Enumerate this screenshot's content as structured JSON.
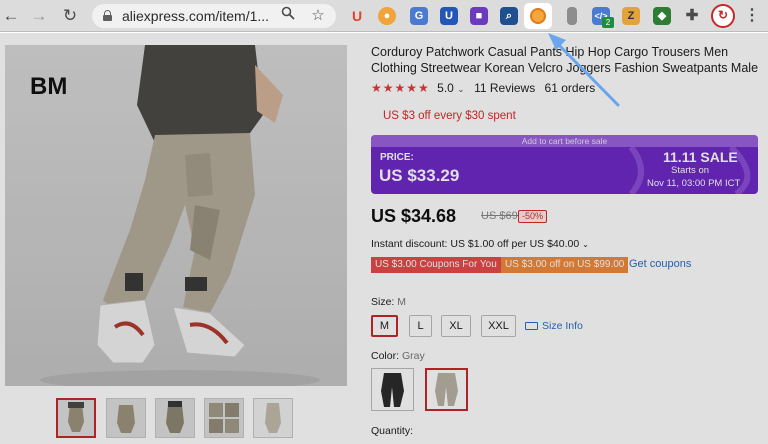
{
  "browser": {
    "url": "aliexpress.com/item/1...",
    "extension_badge": "2"
  },
  "product": {
    "image_label": "BM",
    "title": "Corduroy Patchwork Casual Pants Hip Hop Cargo Trousers Men Clothing Streetwear Korean Velcro Joggers Fashion Sweatpants Male",
    "rating_stars": "★★★★★",
    "rating": "5.0",
    "reviews": "11 Reviews",
    "orders": "61 orders",
    "store_promo": "US $3 off every $30 spent"
  },
  "sale_banner": {
    "top_text": "Add to cart before sale",
    "price_label": "PRICE:",
    "price": "US $33.29",
    "event": "11.11 SALE",
    "starts_label": "Starts on",
    "starts_date": "Nov 11, 03:00 PM ICT"
  },
  "pricing": {
    "current": "US $34.68",
    "original": "US $69.36",
    "discount": "-50%",
    "instant_discount": "Instant discount: US $1.00 off per US $40.00",
    "coupons": [
      "US $3.00 Coupons For You",
      "US $3.00 off on US $99.00"
    ],
    "get_coupons": "Get coupons"
  },
  "size": {
    "label": "Size:",
    "selected": "M",
    "options": [
      "M",
      "L",
      "XL",
      "XXL"
    ],
    "info_link": "Size Info"
  },
  "color": {
    "label": "Color:",
    "selected": "Gray",
    "swatch_colors": [
      "#2c2c2c",
      "#b9b2a5"
    ]
  },
  "quantity": {
    "label": "Quantity:"
  },
  "colors": {
    "sale_purple": "#6f29c7",
    "accent_red": "#e02929",
    "link_blue": "#2a6fc4",
    "annotation_arrow": "#6aa6ee"
  }
}
